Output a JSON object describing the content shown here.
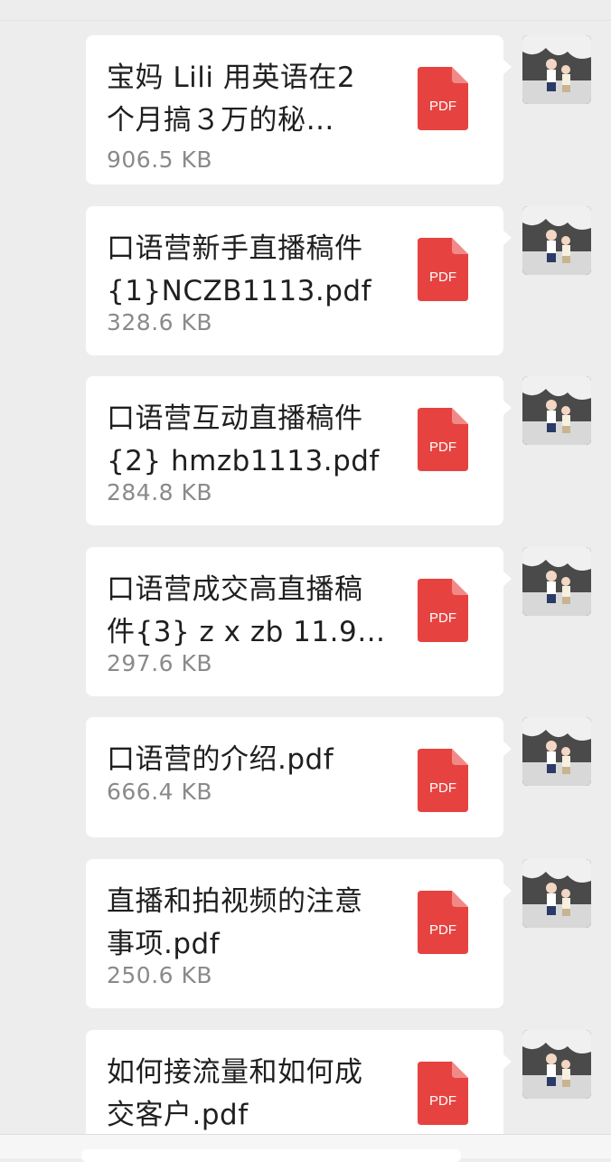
{
  "chat": {
    "messages": [
      {
        "name_lines": "宝妈 Lili 用英语在2\n个月搞３万的秘…",
        "size": "906.5 KB",
        "type_label": "PDF"
      },
      {
        "name_lines": "口语营新手直播稿件\n{1}NCZB1113.pdf",
        "size": "328.6 KB",
        "type_label": "PDF"
      },
      {
        "name_lines": "口语营互动直播稿件\n{2} hmzb1113.pdf",
        "size": "284.8 KB",
        "type_label": "PDF"
      },
      {
        "name_lines": "口语营成交高直播稿\n件{3} z x zb 11.9…",
        "size": "297.6 KB",
        "type_label": "PDF"
      },
      {
        "name_lines": "口语营的介绍.pdf",
        "size": "666.4 KB",
        "type_label": "PDF"
      },
      {
        "name_lines": "直播和拍视频的注意\n事项.pdf",
        "size": "250.6 KB",
        "type_label": "PDF"
      },
      {
        "name_lines": "如何接流量和如何成\n交客户.pdf",
        "size": "",
        "type_label": "PDF"
      }
    ]
  },
  "colors": {
    "background": "#ededed",
    "bubble": "#ffffff",
    "pdf_red": "#e64340",
    "size_text": "#8a8a8a"
  },
  "icons": {
    "file": "pdf-file-icon",
    "sender": "avatar-image"
  }
}
